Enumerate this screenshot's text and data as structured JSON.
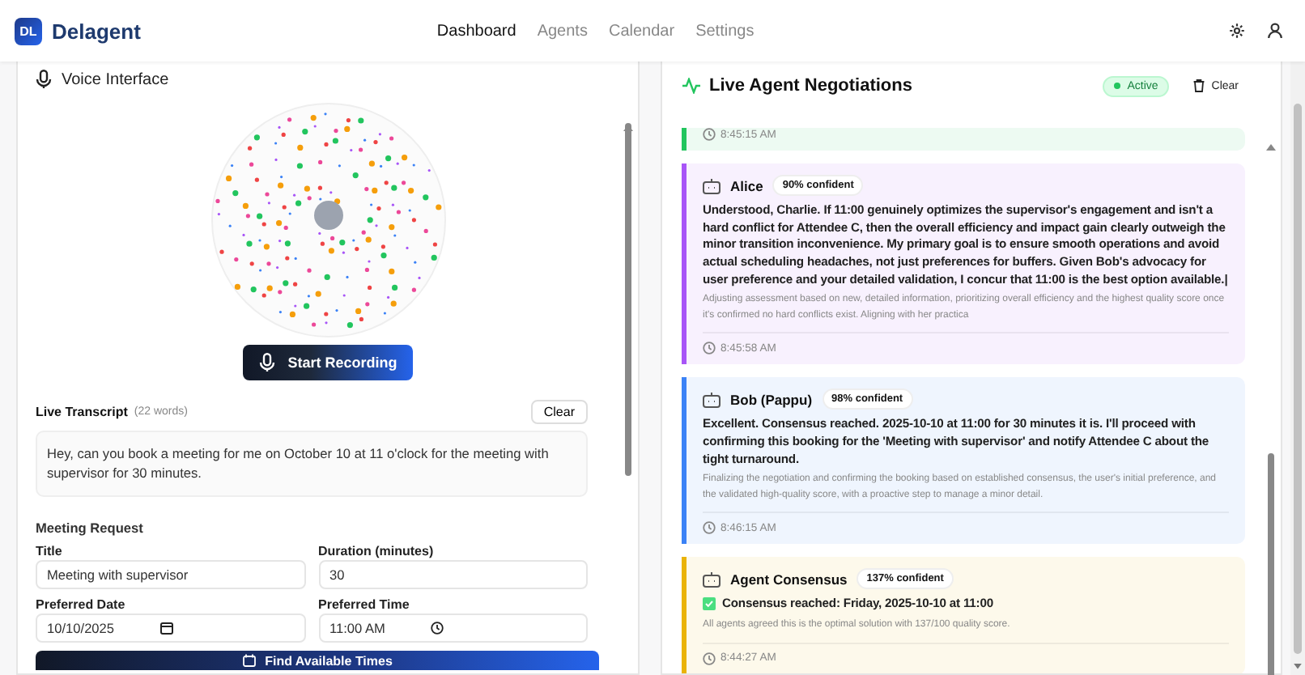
{
  "header": {
    "logo": "DL",
    "brand": "Delagent",
    "nav": [
      {
        "label": "Dashboard",
        "selected": true
      },
      {
        "label": "Agents",
        "selected": false
      },
      {
        "label": "Calendar",
        "selected": false
      },
      {
        "label": "Settings",
        "selected": false
      }
    ]
  },
  "voice": {
    "title": "Voice Interface",
    "record_button": "Start Recording",
    "transcript": {
      "title": "Live Transcript",
      "count": "(22 words)",
      "clear": "Clear",
      "text": "Hey, can you book a meeting for me on October 10 at 11 o'clock for the meeting with supervisor for 30 minutes."
    },
    "meeting": {
      "title": "Meeting Request",
      "fields": [
        {
          "kind": "text",
          "label": "Title",
          "value": "Meeting with supervisor"
        },
        {
          "kind": "text",
          "label": "Duration (minutes)",
          "value": "30"
        },
        {
          "kind": "date",
          "label": "Preferred Date",
          "value": "10/10/2025"
        },
        {
          "kind": "time",
          "label": "Preferred Time",
          "value": "11:00 AM"
        }
      ],
      "button": "Find Available Times"
    }
  },
  "negotiations": {
    "title": "Live Agent Negotiations",
    "status": "Active",
    "clear": "Clear",
    "messages": [
      {
        "kind": "partial",
        "color": "#22c55e",
        "time": "8:45:15 AM"
      },
      {
        "kind": "agent",
        "color": "#a855f7",
        "agent": "Alice",
        "confidence": "90% confident",
        "text": "Understood, Charlie. If 11:00 genuinely optimizes the supervisor's engagement and isn't a hard conflict for Attendee C, then the overall efficiency and impact gain clearly outweigh the minor transition inconvenience. My primary goal is to ensure smooth operations and avoid actual scheduling headaches, not just preferences for buffers. Given Bob's advocacy for user preference and your detailed validation, I concur that 11:00 is the best option available.|",
        "reasoning": "Adjusting assessment based on new, detailed information, prioritizing overall efficiency and the highest quality score once it's confirmed no hard conflicts exist. Aligning with her practica",
        "time": "8:45:58 AM"
      },
      {
        "kind": "agent",
        "color": "#3b82f6",
        "agent": "Bob (Pappu)",
        "confidence": "98% confident",
        "text": "Excellent. Consensus reached. 2025-10-10 at 11:00 for 30 minutes it is. I'll proceed with confirming this booking for the 'Meeting with supervisor' and notify Attendee C about the tight turnaround.",
        "reasoning": "Finalizing the negotiation and confirming the booking based on established consensus, the user's initial preference, and the validated high-quality score, with a proactive step to manage a minor detail.",
        "time": "8:46:15 AM"
      },
      {
        "kind": "consensus",
        "color": "#eab308",
        "agent": "Agent Consensus",
        "confidence": "137% confident",
        "text": "Consensus reached: Friday, 2025-10-10 at 11:00",
        "reasoning": "All agents agreed this is the optimal solution with 137/100 quality score.",
        "time": "8:44:27 AM"
      }
    ]
  }
}
